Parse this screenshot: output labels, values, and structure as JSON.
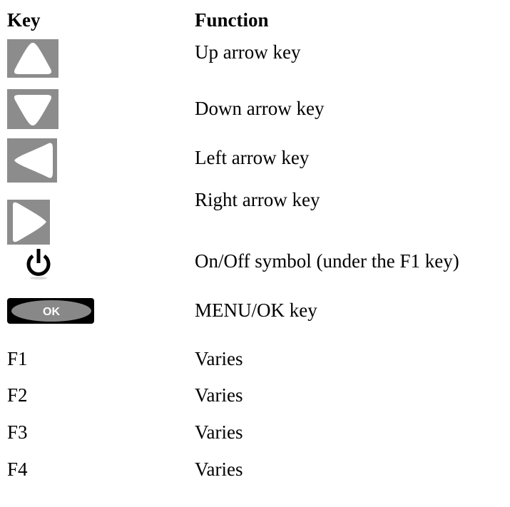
{
  "header": {
    "key": "Key",
    "function": "Function"
  },
  "rows": [
    {
      "icon": "up-arrow-icon",
      "function": "Up arrow key"
    },
    {
      "icon": "down-arrow-icon",
      "function": "Down arrow key"
    },
    {
      "icon": "left-arrow-icon",
      "function": "Left arrow key"
    },
    {
      "icon": "right-arrow-icon",
      "function": "Right arrow key"
    },
    {
      "icon": "power-icon",
      "function": "On/Off symbol (under the F1 key)"
    },
    {
      "icon": "ok-button-icon",
      "icon_text": "OK",
      "function": "MENU/OK key"
    },
    {
      "key": "F1",
      "function": "Varies"
    },
    {
      "key": "F2",
      "function": "Varies"
    },
    {
      "key": "F3",
      "function": "Varies"
    },
    {
      "key": "F4",
      "function": "Varies"
    }
  ],
  "colors": {
    "arrow_tile": "#8c8c8c",
    "ok_button_fill": "#888888",
    "ok_button_border": "#000000"
  }
}
